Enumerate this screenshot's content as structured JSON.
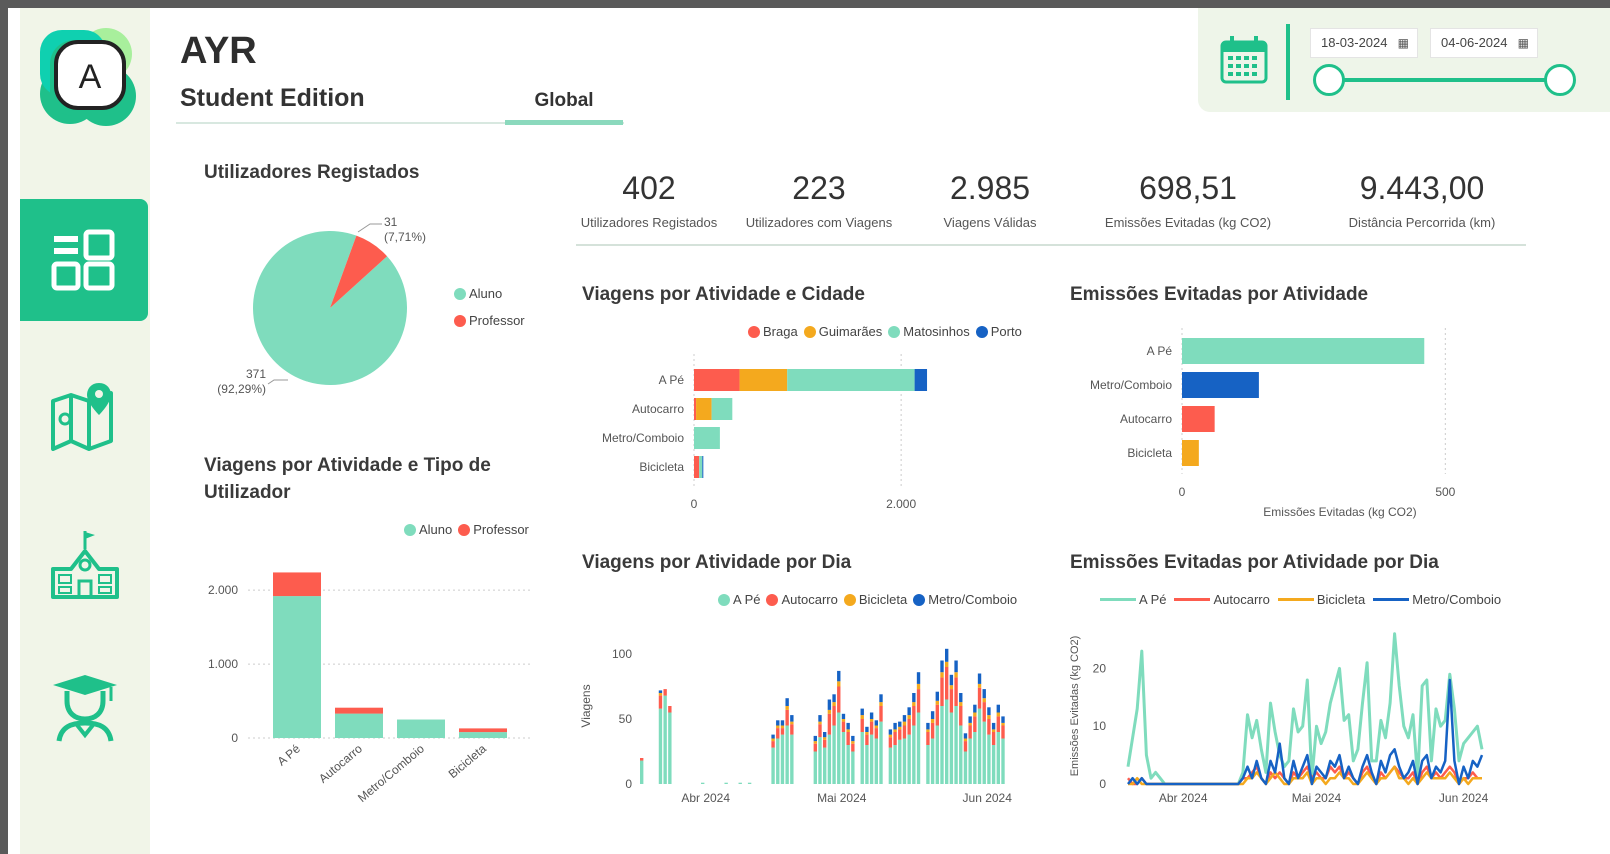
{
  "app": {
    "title": "AYR",
    "subtitle": "Student Edition",
    "logo_letter": "A",
    "active_tab": "Global"
  },
  "nav": [
    {
      "name": "dashboard-icon",
      "active": true
    },
    {
      "name": "map-icon",
      "active": false
    },
    {
      "name": "school-icon",
      "active": false
    },
    {
      "name": "student-icon",
      "active": false
    }
  ],
  "date_filter": {
    "start": "18-03-2024",
    "end": "04-06-2024",
    "icon": "calendar-icon"
  },
  "colors": {
    "aluno": "#7fdcbd",
    "professor": "#fd5c4e",
    "braga": "#fd5c4e",
    "guimaraes": "#f4a91e",
    "matosinhos": "#7fdcbd",
    "porto": "#1662c4",
    "accent": "#1fc08a"
  },
  "kpis": [
    {
      "value": "402",
      "label": "Utilizadores Registados"
    },
    {
      "value": "223",
      "label": "Utilizadores com Viagens"
    },
    {
      "value": "2.985",
      "label": "Viagens Válidas"
    },
    {
      "value": "698,51",
      "label": "Emissões Evitadas (kg CO2)"
    },
    {
      "value": "9.443,00",
      "label": "Distância Percorrida (km)"
    }
  ],
  "titles": {
    "users_pie": "Utilizadores Registados",
    "trips_user_type": "Viagens por Atividade e Tipo de Utilizador",
    "trips_city": "Viagens por Atividade e Cidade",
    "emissions_activity": "Emissões Evitadas por Atividade",
    "trips_day": "Viagens por Atividade por Dia",
    "emissions_day": "Emissões Evitadas por Atividade por Dia"
  },
  "legends": {
    "user_type": [
      "Aluno",
      "Professor"
    ],
    "city": [
      "Braga",
      "Guimarães",
      "Matosinhos",
      "Porto"
    ],
    "activity_day": [
      "A Pé",
      "Autocarro",
      "Bicicleta",
      "Metro/Comboio"
    ]
  },
  "chart_data": [
    {
      "id": "users_pie",
      "type": "pie",
      "title": "Utilizadores Registados",
      "slices": [
        {
          "label": "Aluno",
          "value": 371,
          "text": "371",
          "pct": "(92,29%)"
        },
        {
          "label": "Professor",
          "value": 31,
          "text": "31",
          "pct": "(7,71%)"
        }
      ]
    },
    {
      "id": "trips_user_type",
      "type": "bar",
      "title": "Viagens por Atividade e Tipo de Utilizador",
      "categories": [
        "A Pé",
        "Autocarro",
        "Metro/Comboio",
        "Bicicleta"
      ],
      "series": [
        {
          "name": "Aluno",
          "values": [
            1920,
            330,
            250,
            80
          ]
        },
        {
          "name": "Professor",
          "values": [
            320,
            80,
            0,
            50
          ]
        }
      ],
      "ylim": [
        0,
        2300
      ],
      "yticks": [
        "0",
        "1.000",
        "2.000"
      ]
    },
    {
      "id": "trips_city",
      "type": "bar",
      "orientation": "horizontal",
      "title": "Viagens por Atividade e Cidade",
      "categories": [
        "A Pé",
        "Autocarro",
        "Metro/Comboio",
        "Bicicleta"
      ],
      "series": [
        {
          "name": "Braga",
          "values": [
            440,
            20,
            0,
            50
          ]
        },
        {
          "name": "Guimarães",
          "values": [
            460,
            150,
            0,
            0
          ]
        },
        {
          "name": "Matosinhos",
          "values": [
            1230,
            200,
            250,
            30
          ]
        },
        {
          "name": "Porto",
          "values": [
            120,
            0,
            0,
            10
          ]
        }
      ],
      "xlim": [
        0,
        2800
      ],
      "xticks": [
        "0",
        "2.000"
      ]
    },
    {
      "id": "emissions_activity",
      "type": "bar",
      "orientation": "horizontal",
      "title": "Emissões Evitadas por Atividade",
      "categories": [
        "A Pé",
        "Metro/Comboio",
        "Autocarro",
        "Bicicleta"
      ],
      "values": [
        460,
        146,
        62,
        32
      ],
      "xlabel": "Emissões Evitadas (kg CO2)",
      "xlim": [
        0,
        600
      ],
      "xticks": [
        "0",
        "500"
      ]
    },
    {
      "id": "trips_day",
      "type": "bar",
      "stacked": true,
      "title": "Viagens por Atividade por Dia",
      "ylabel": "Viagens",
      "ylim": [
        0,
        120
      ],
      "yticks": [
        "0",
        "50",
        "100"
      ],
      "xticks": [
        "Abr 2024",
        "Mai 2024",
        "Jun 2024"
      ],
      "days": 78,
      "series": [
        {
          "name": "A Pé",
          "values": [
            18,
            0,
            0,
            0,
            58,
            68,
            55,
            0,
            0,
            0,
            0,
            0,
            0,
            1,
            0,
            0,
            0,
            0,
            1,
            0,
            0,
            1,
            0,
            1,
            0,
            0,
            0,
            0,
            28,
            35,
            38,
            45,
            38,
            0,
            0,
            0,
            0,
            25,
            36,
            28,
            38,
            45,
            55,
            40,
            30,
            25,
            0,
            40,
            30,
            38,
            35,
            48,
            0,
            28,
            30,
            34,
            35,
            38,
            45,
            55,
            0,
            30,
            35,
            45,
            60,
            65,
            55,
            60,
            45,
            25,
            35,
            40,
            58,
            48,
            38,
            30,
            40,
            35
          ]
        },
        {
          "name": "Autocarro",
          "values": [
            2,
            0,
            0,
            0,
            10,
            5,
            5,
            0,
            0,
            0,
            0,
            0,
            0,
            0,
            0,
            0,
            0,
            0,
            0,
            0,
            0,
            0,
            0,
            0,
            0,
            0,
            0,
            0,
            5,
            8,
            5,
            12,
            8,
            0,
            0,
            0,
            0,
            6,
            10,
            6,
            16,
            15,
            20,
            8,
            10,
            6,
            0,
            10,
            8,
            10,
            8,
            12,
            0,
            8,
            10,
            8,
            10,
            12,
            15,
            18,
            0,
            10,
            12,
            16,
            22,
            25,
            18,
            22,
            15,
            8,
            10,
            12,
            16,
            15,
            12,
            10,
            12,
            10
          ]
        },
        {
          "name": "Bicicleta",
          "values": [
            0,
            0,
            0,
            0,
            2,
            0,
            0,
            0,
            0,
            0,
            0,
            0,
            0,
            0,
            0,
            0,
            0,
            0,
            0,
            0,
            0,
            0,
            0,
            0,
            0,
            0,
            0,
            0,
            2,
            2,
            2,
            3,
            2,
            0,
            0,
            0,
            0,
            2,
            2,
            2,
            3,
            3,
            4,
            2,
            2,
            2,
            0,
            3,
            2,
            2,
            2,
            3,
            0,
            2,
            2,
            2,
            3,
            3,
            3,
            4,
            0,
            2,
            3,
            3,
            4,
            4,
            3,
            4,
            3,
            2,
            2,
            3,
            3,
            3,
            3,
            2,
            3,
            2
          ]
        },
        {
          "name": "Metro/Comboio",
          "values": [
            0,
            0,
            0,
            0,
            2,
            0,
            0,
            0,
            0,
            0,
            0,
            0,
            0,
            0,
            0,
            0,
            0,
            0,
            0,
            0,
            0,
            0,
            0,
            0,
            0,
            0,
            0,
            0,
            3,
            4,
            4,
            6,
            5,
            0,
            0,
            0,
            0,
            4,
            5,
            4,
            8,
            6,
            8,
            4,
            5,
            4,
            0,
            5,
            4,
            5,
            4,
            6,
            0,
            4,
            5,
            4,
            5,
            6,
            7,
            9,
            0,
            5,
            6,
            7,
            9,
            10,
            8,
            9,
            7,
            4,
            5,
            6,
            8,
            7,
            6,
            5,
            6,
            5
          ]
        }
      ]
    },
    {
      "id": "emissions_day",
      "type": "line",
      "title": "Emissões Evitadas por Atividade por Dia",
      "ylabel": "Emissões Evitadas (kg CO2)",
      "ylim": [
        0,
        27
      ],
      "yticks": [
        "0",
        "10",
        "20"
      ],
      "xticks": [
        "Abr 2024",
        "Mai 2024",
        "Jun 2024"
      ],
      "series": [
        {
          "name": "A Pé",
          "values": [
            3,
            8,
            13,
            23,
            5,
            1,
            2,
            1,
            0,
            0,
            0,
            0,
            0,
            0,
            0,
            0,
            0,
            0,
            0,
            0,
            0,
            0,
            0,
            0,
            0,
            2,
            12,
            8,
            11,
            6,
            2,
            14,
            9,
            5,
            3,
            4,
            13,
            9,
            10,
            18,
            1,
            10,
            7,
            9,
            14,
            17,
            20,
            11,
            12,
            4,
            6,
            14,
            21,
            4,
            4,
            11,
            8,
            14,
            26,
            17,
            10,
            8,
            12,
            1,
            17,
            18,
            4,
            13,
            10,
            11,
            19,
            13,
            4,
            7,
            8,
            9,
            10,
            6
          ]
        },
        {
          "name": "Autocarro",
          "values": [
            1,
            0,
            0,
            1,
            0,
            0,
            0,
            0,
            0,
            0,
            0,
            0,
            0,
            0,
            0,
            0,
            0,
            0,
            0,
            0,
            0,
            0,
            0,
            0,
            0,
            1,
            1,
            2,
            3,
            1,
            0,
            2,
            1,
            2,
            1,
            0,
            2,
            1,
            2,
            3,
            1,
            2,
            1,
            1,
            3,
            2,
            3,
            1,
            2,
            1,
            0,
            2,
            3,
            1,
            0,
            2,
            1,
            2,
            3,
            2,
            1,
            1,
            2,
            0,
            2,
            3,
            1,
            2,
            1,
            2,
            3,
            2,
            0,
            1,
            1,
            2,
            1,
            1
          ]
        },
        {
          "name": "Bicicleta",
          "values": [
            0,
            0,
            1,
            0,
            0,
            0,
            0,
            0,
            0,
            0,
            0,
            0,
            0,
            0,
            0,
            0,
            0,
            0,
            0,
            0,
            0,
            0,
            0,
            0,
            0,
            0,
            1,
            1,
            2,
            1,
            0,
            1,
            2,
            1,
            0,
            0,
            1,
            1,
            1,
            2,
            0,
            1,
            1,
            0,
            1,
            1,
            2,
            1,
            1,
            0,
            0,
            1,
            2,
            1,
            0,
            1,
            1,
            2,
            3,
            1,
            1,
            0,
            1,
            0,
            1,
            2,
            1,
            1,
            1,
            1,
            2,
            1,
            0,
            1,
            0,
            1,
            1,
            1
          ]
        },
        {
          "name": "Metro/Comboio",
          "values": [
            0,
            1,
            0,
            1,
            0,
            0,
            0,
            0,
            0,
            0,
            0,
            0,
            0,
            0,
            0,
            0,
            0,
            0,
            0,
            0,
            0,
            0,
            0,
            0,
            0,
            1,
            3,
            1,
            4,
            1,
            0,
            4,
            2,
            7,
            1,
            0,
            4,
            1,
            3,
            5,
            0,
            3,
            2,
            1,
            4,
            3,
            5,
            1,
            3,
            1,
            0,
            3,
            5,
            2,
            0,
            4,
            2,
            5,
            6,
            3,
            1,
            2,
            4,
            0,
            4,
            5,
            1,
            3,
            2,
            4,
            18,
            4,
            0,
            3,
            1,
            4,
            3,
            5
          ]
        }
      ]
    }
  ]
}
